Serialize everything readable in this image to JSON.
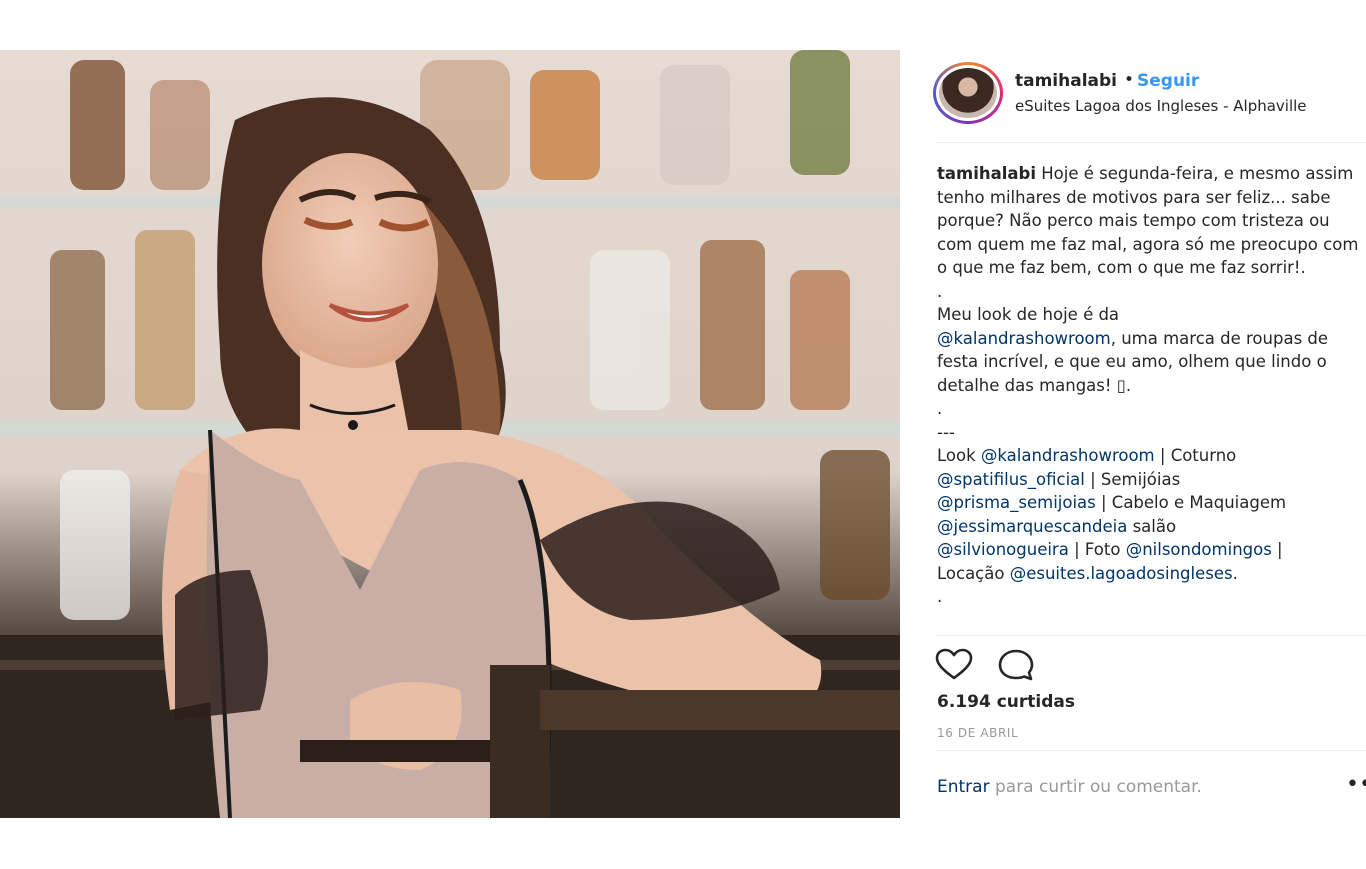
{
  "post": {
    "username": "tamihalabi",
    "separator": "•",
    "follow_label": "Seguir",
    "location": "eSuites Lagoa dos Ingleses - Alphaville",
    "caption": {
      "author": "tamihalabi",
      "p1": " Hoje é segunda-feira, e mesmo assim tenho milhares de motivos para ser feliz... sabe porque? Não perco mais tempo com tristeza ou com quem me faz mal, agora só me preocupo com o que me faz bem, com o que me faz sorrir!.",
      "dot1": ".",
      "p2_start": "Meu look de hoje é da",
      "mention_kalandra": "@kalandrashowroom",
      "p2_end": ", uma marca de roupas de festa incrível, e que eu amo, olhem que lindo o detalhe das mangas! ",
      "emoji_placeholder": "▯",
      "p2_tail": ".",
      "dot2": ".",
      "dashes": "---",
      "look_label": "Look ",
      "coturno": " | Coturno",
      "mention_spatifilus": "@spatifilus_oficial",
      "semijoias": " | Semijóias",
      "mention_prisma": "@prisma_semijoias",
      "cabelo": " | Cabelo e Maquiagem",
      "mention_jessi": "@jessimarquescandeia",
      "salao": " salão",
      "mention_silvio": "@silvionogueira",
      "foto": " | Foto ",
      "mention_nilson": "@nilsondomingos",
      "pipe": " |",
      "locacao": "Locação ",
      "mention_esuites": "@esuites.lagoadosingleses",
      "period": ".",
      "dot3": "."
    },
    "likes": "6.194 curtidas",
    "date": "16 DE ABRIL",
    "login_link": "Entrar",
    "login_text": " para curtir ou comentar.",
    "more_label": "•••"
  },
  "icons": {
    "like": "heart-outline-icon",
    "comment": "comment-bubble-icon",
    "more": "more-options-icon"
  },
  "colors": {
    "link_blue": "#3897f0",
    "mention_blue": "#003569",
    "text": "#262626",
    "muted": "#999999"
  }
}
